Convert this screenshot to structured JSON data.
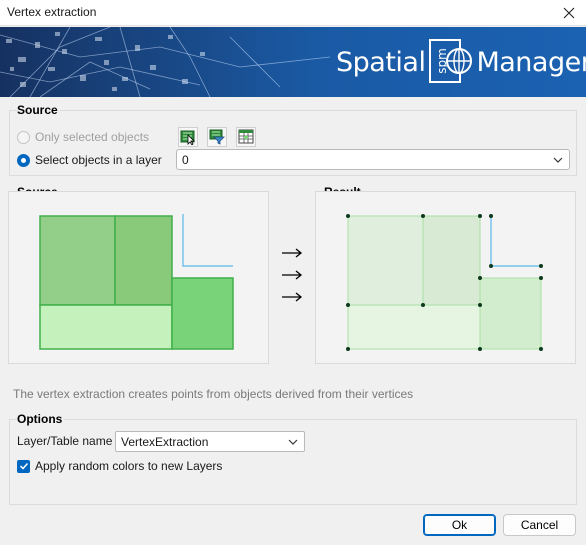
{
  "window": {
    "title": "Vertex extraction"
  },
  "banner": {
    "brand_left": "Spatial",
    "brand_logo": "spm",
    "brand_right": "Manager"
  },
  "source_group": {
    "title": "Source",
    "option_only_selected": "Only selected objects",
    "option_select_in_layer": "Select objects in a layer",
    "selected_option": "Select objects in a layer",
    "layer_value": "0",
    "tools": [
      "select-objects-icon",
      "filter-objects-icon",
      "table-select-icon"
    ]
  },
  "preview": {
    "source_label": "Source",
    "result_label": "Result",
    "arrow_glyph": "→",
    "fill_colors": {
      "dark": "#79d479",
      "mid": "#93cf88",
      "light": "#c5f2bc",
      "result_fill": "#e2f0df",
      "result_stroke": "#a9e0a4"
    },
    "line_color": "#5bb7ec",
    "vertex_color": "#0d3a1c"
  },
  "description": "The vertex extraction creates points from objects derived from their vertices",
  "options_group": {
    "title": "Options",
    "layer_table_label": "Layer/Table name",
    "layer_table_value": "VertexExtraction",
    "random_colors_label": "Apply random colors to new Layers",
    "random_colors_checked": true
  },
  "buttons": {
    "ok": "Ok",
    "cancel": "Cancel"
  },
  "accent": "#0067c0"
}
